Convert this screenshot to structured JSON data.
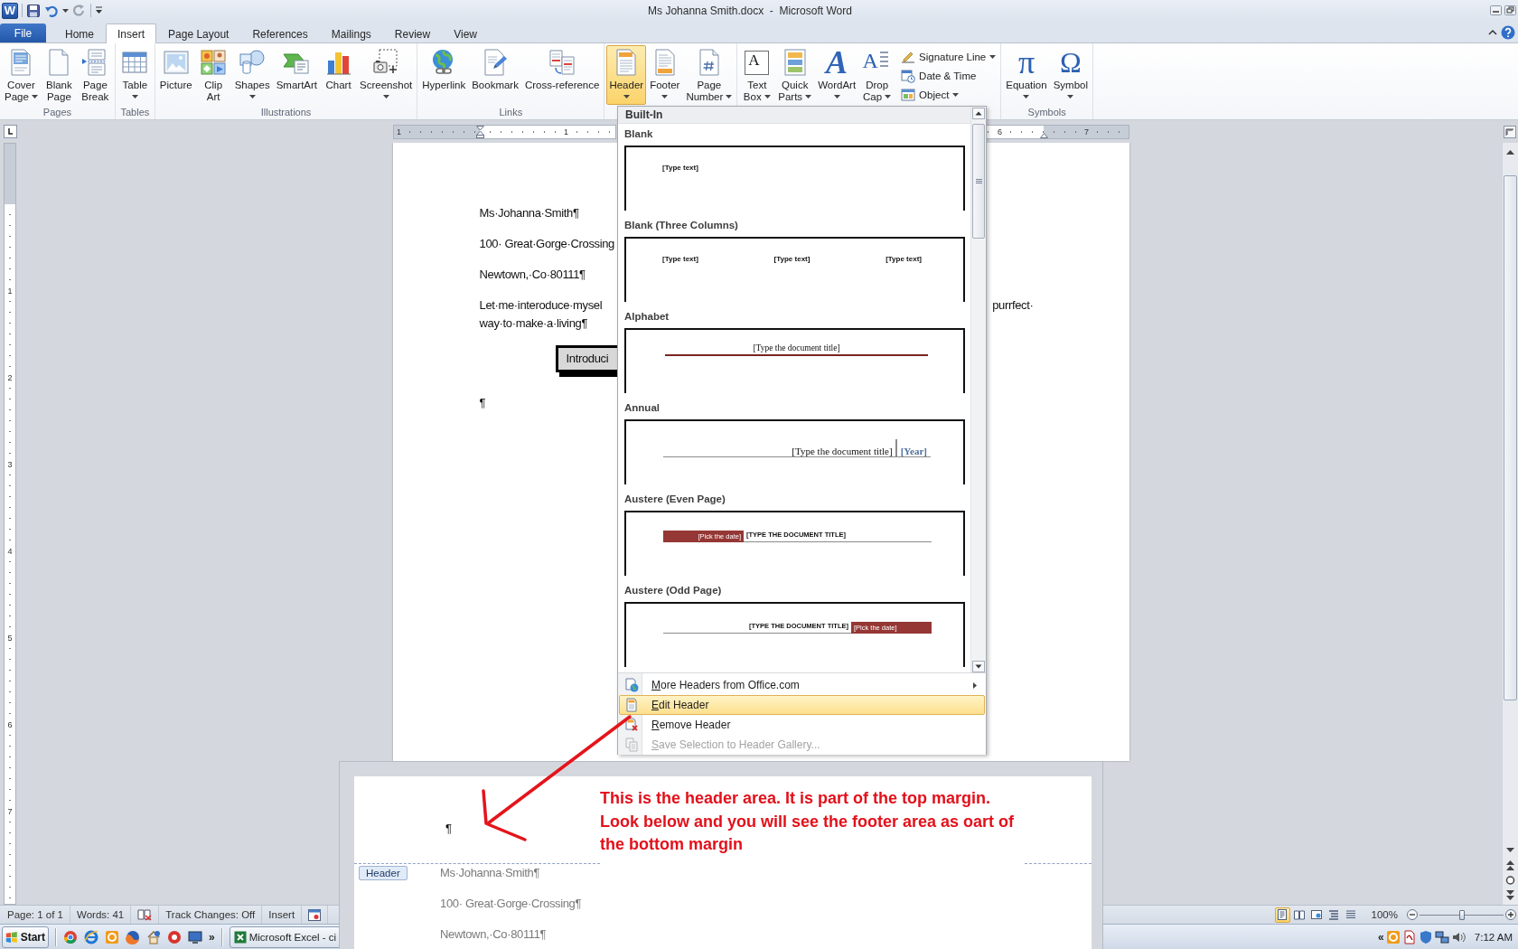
{
  "window": {
    "logo": "W",
    "title": "Ms Johanna Smith.docx  -  Microsoft Word"
  },
  "tabs": [
    {
      "label": "File",
      "kind": "file",
      "selected": false
    },
    {
      "label": "Home",
      "kind": "tab",
      "selected": false
    },
    {
      "label": "Insert",
      "kind": "tab",
      "selected": true
    },
    {
      "label": "Page Layout",
      "kind": "tab",
      "selected": false
    },
    {
      "label": "References",
      "kind": "tab",
      "selected": false
    },
    {
      "label": "Mailings",
      "kind": "tab",
      "selected": false
    },
    {
      "label": "Review",
      "kind": "tab",
      "selected": false
    },
    {
      "label": "View",
      "kind": "tab",
      "selected": false
    }
  ],
  "ribbon": {
    "groups": [
      {
        "label": "Pages",
        "buttons": [
          {
            "kind": "cover",
            "lines": [
              "Cover",
              "Page"
            ],
            "menu": true,
            "pressed": false
          },
          {
            "kind": "blank",
            "lines": [
              "Blank",
              "Page"
            ],
            "menu": false,
            "pressed": false
          },
          {
            "kind": "break",
            "lines": [
              "Page",
              "Break"
            ],
            "menu": false,
            "pressed": false
          }
        ]
      },
      {
        "label": "Tables",
        "buttons": [
          {
            "kind": "table",
            "lines": [
              "Table"
            ],
            "menu": true,
            "pressed": false
          }
        ]
      },
      {
        "label": "Illustrations",
        "buttons": [
          {
            "kind": "picture",
            "lines": [
              "Picture"
            ],
            "menu": false,
            "pressed": false
          },
          {
            "kind": "clipart",
            "lines": [
              "Clip",
              "Art"
            ],
            "menu": false,
            "pressed": false
          },
          {
            "kind": "shapes",
            "lines": [
              "Shapes"
            ],
            "menu": true,
            "pressed": false
          },
          {
            "kind": "smartart",
            "lines": [
              "SmartArt"
            ],
            "menu": false,
            "pressed": false
          },
          {
            "kind": "chart",
            "lines": [
              "Chart"
            ],
            "menu": false,
            "pressed": false
          },
          {
            "kind": "screenshot",
            "lines": [
              "Screenshot"
            ],
            "menu": true,
            "pressed": false
          }
        ]
      },
      {
        "label": "Links",
        "buttons": [
          {
            "kind": "hyperlink",
            "lines": [
              "Hyperlink"
            ],
            "menu": false,
            "pressed": false
          },
          {
            "kind": "bookmark",
            "lines": [
              "Bookmark"
            ],
            "menu": false,
            "pressed": false
          },
          {
            "kind": "crossref",
            "lines": [
              "Cross-reference"
            ],
            "menu": false,
            "pressed": false
          }
        ]
      },
      {
        "buttons": [
          {
            "kind": "header",
            "lines": [
              "Header"
            ],
            "menu": true,
            "pressed": true
          },
          {
            "kind": "footer",
            "lines": [
              "Footer"
            ],
            "menu": true,
            "pressed": false
          },
          {
            "kind": "pagenumber",
            "lines": [
              "Page",
              "Number"
            ],
            "menu": true,
            "pressed": false
          }
        ]
      },
      {
        "buttons": [
          {
            "kind": "textbox",
            "glyph": "A",
            "lines": [
              "Text",
              "Box"
            ],
            "menu": true,
            "pressed": false
          },
          {
            "kind": "quickparts",
            "lines": [
              "Quick",
              "Parts"
            ],
            "menu": true,
            "pressed": false
          },
          {
            "kind": "wordart",
            "glyph": "A",
            "lines": [
              "WordArt"
            ],
            "menu": true,
            "pressed": false
          },
          {
            "kind": "dropcap",
            "glyph": "A",
            "lines": [
              "Drop",
              "Cap"
            ],
            "menu": true,
            "pressed": false
          }
        ],
        "small": [
          {
            "kind": "signature",
            "label": "Signature Line",
            "menu": true
          },
          {
            "kind": "datetime",
            "label": "Date & Time",
            "menu": false
          },
          {
            "kind": "object",
            "label": "Object",
            "menu": true
          }
        ]
      },
      {
        "label": "Symbols",
        "buttons": [
          {
            "kind": "equation",
            "glyph": "π",
            "lines": [
              "Equation"
            ],
            "menu": true,
            "pressed": false
          },
          {
            "kind": "symbol",
            "glyph": "Ω",
            "lines": [
              "Symbol"
            ],
            "menu": true,
            "pressed": false
          }
        ]
      }
    ]
  },
  "document": {
    "ruler": {
      "labels": [
        "1",
        "1",
        "6",
        "7"
      ]
    },
    "vertical_ruler": {
      "labels": [
        "1",
        "2",
        "3",
        "4",
        "5",
        "6",
        "7"
      ]
    },
    "paragraphs": [
      {
        "kind": "line",
        "text": "Ms·Johanna·Smith¶"
      },
      {
        "kind": "line",
        "text": "100· Great·Gorge·Crossing"
      },
      {
        "kind": "line",
        "text": "Newtown,·Co·80111¶"
      },
      {
        "kind": "split",
        "text": "Let·me·interoduce·mysel",
        "after": "purrfect·",
        "next": "way·to·make·a·living¶"
      },
      {
        "kind": "textbox",
        "text": "Introduci"
      },
      {
        "kind": "line",
        "text": "¶"
      }
    ]
  },
  "header_menu": {
    "heading": "Built-In",
    "items": [
      {
        "kind": "blank",
        "name": "Blank",
        "texts": [
          "[Type text]"
        ]
      },
      {
        "kind": "three",
        "name": "Blank (Three Columns)",
        "texts": [
          "[Type text]",
          "[Type text]",
          "[Type text]"
        ]
      },
      {
        "kind": "alphabet",
        "name": "Alphabet",
        "texts": [
          "[Type the document title]"
        ]
      },
      {
        "kind": "annual",
        "name": "Annual",
        "texts": [
          "[Type the document title]",
          "[Year]"
        ]
      },
      {
        "kind": "even",
        "name": "Austere (Even Page)",
        "texts": [
          "[Pick the date]",
          "[TYPE THE DOCUMENT TITLE]"
        ]
      },
      {
        "kind": "odd",
        "name": "Austere (Odd Page)",
        "texts": [
          "[TYPE THE DOCUMENT TITLE]",
          "[Pick the date]"
        ]
      }
    ],
    "commands": [
      {
        "kind": "more",
        "label": "More Headers from Office.com",
        "submenu": true,
        "selected": false,
        "disabled": false
      },
      {
        "kind": "edit",
        "label": "Edit Header",
        "submenu": false,
        "selected": true,
        "disabled": false
      },
      {
        "kind": "remove",
        "label": "Remove Header",
        "submenu": false,
        "selected": false,
        "disabled": false
      },
      {
        "kind": "save",
        "label": "Save Selection to Header Gallery...",
        "submenu": false,
        "selected": false,
        "disabled": true
      }
    ]
  },
  "inset": {
    "mark": "¶",
    "note": "This is the header area. It is part of the top margin. Look below and you will see the footer area as oart of the bottom margin",
    "tag": "Header",
    "lines": [
      "Ms·Johanna·Smith¶",
      "100· Great·Gorge·Crossing¶",
      "Newtown,·Co·80111¶"
    ]
  },
  "status_bar": {
    "items": [
      {
        "kind": "text",
        "label": "Page: 1 of 1"
      },
      {
        "kind": "text",
        "label": "Words: 41"
      },
      {
        "kind": "proofing"
      },
      {
        "kind": "text",
        "label": "Track Changes: Off"
      },
      {
        "kind": "text",
        "label": "Insert"
      },
      {
        "kind": "macro"
      }
    ],
    "views": [
      {
        "kind": "print",
        "selected": true
      },
      {
        "kind": "reading",
        "selected": false
      },
      {
        "kind": "web",
        "selected": false
      },
      {
        "kind": "outline",
        "selected": false
      },
      {
        "kind": "draft",
        "selected": false
      }
    ],
    "zoom": "100%",
    "zoom_slider": {
      "level": 0.5
    }
  },
  "taskbar": {
    "start": "Start",
    "more": "»",
    "tasks": [
      {
        "label": "Microsoft Excel - ci"
      }
    ],
    "tray_more": "«",
    "clock": "7:12 AM"
  }
}
